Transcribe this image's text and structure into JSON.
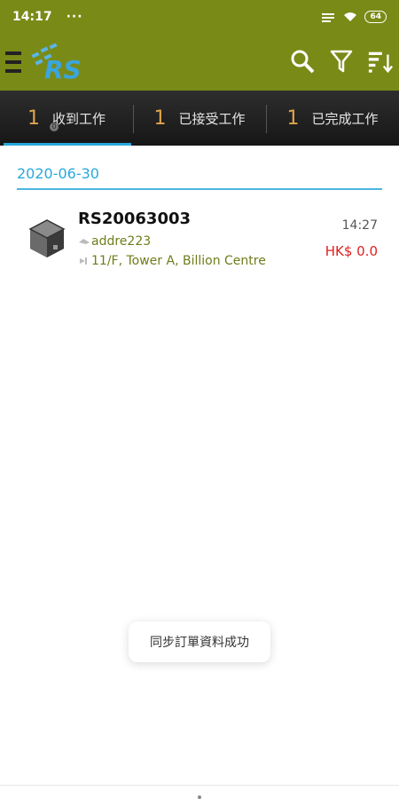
{
  "status_bar": {
    "time": "14:17",
    "dots": "···",
    "battery": "64"
  },
  "app_bar": {
    "logo_text": "RS",
    "icons": [
      "menu-icon",
      "search-icon",
      "filter-icon",
      "sort-icon"
    ],
    "color": "#7a8a17"
  },
  "tabs": [
    {
      "count": "1",
      "label": "收到工作",
      "active": true,
      "badge": "0"
    },
    {
      "count": "1",
      "label": "已接受工作",
      "active": false
    },
    {
      "count": "1",
      "label": "已完成工作",
      "active": false
    }
  ],
  "date_group": "2020-06-30",
  "order": {
    "id": "RS20063003",
    "sender": "addre223",
    "address": "11/F, Tower A, Billion Centre",
    "time": "14:27",
    "price": "HK$ 0.0"
  },
  "toast": "同步訂單資料成功",
  "colors": {
    "accent": "#2aa8db",
    "tab_count": "#e0a44a",
    "price": "#e02020",
    "sub_text": "#6f7c1b"
  }
}
